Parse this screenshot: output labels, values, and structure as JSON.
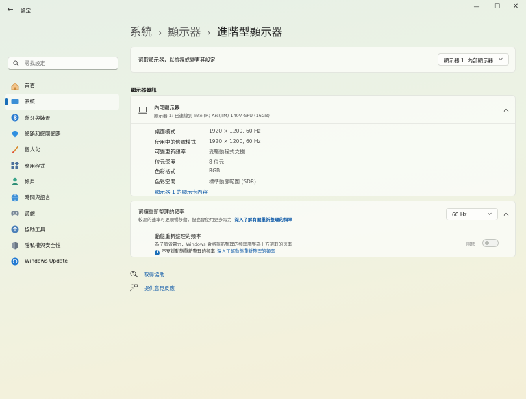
{
  "window": {
    "app_title": "設定",
    "back_label": "←",
    "minimize_label": "—",
    "maximize_label": "☐",
    "close_label": "✕"
  },
  "breadcrumb": {
    "level1": "系統",
    "level2": "顯示器",
    "current": "進階型顯示器",
    "separator": "›"
  },
  "search": {
    "placeholder": "尋找設定"
  },
  "sidebar": {
    "items": [
      {
        "label": "首頁",
        "icon": "home-icon"
      },
      {
        "label": "系統",
        "icon": "system-icon",
        "active": true
      },
      {
        "label": "藍牙與裝置",
        "icon": "bluetooth-icon"
      },
      {
        "label": "網路和網際網路",
        "icon": "wifi-icon"
      },
      {
        "label": "個人化",
        "icon": "brush-icon"
      },
      {
        "label": "應用程式",
        "icon": "apps-icon"
      },
      {
        "label": "帳戶",
        "icon": "person-icon"
      },
      {
        "label": "時間與語言",
        "icon": "globe-clock-icon"
      },
      {
        "label": "遊戲",
        "icon": "gamepad-icon"
      },
      {
        "label": "協助工具",
        "icon": "accessibility-icon"
      },
      {
        "label": "隱私權與安全性",
        "icon": "shield-icon"
      },
      {
        "label": "Windows Update",
        "icon": "update-icon"
      }
    ]
  },
  "select_display": {
    "label": "選取顯示器，以檢視或變更其設定",
    "selected": "顯示器 1: 內部顯示器"
  },
  "display_info": {
    "heading": "顯示器資訊",
    "title": "內部顯示器",
    "subtitle": "顯示器 1: 已連線到 Intel(R) Arc(TM) 140V GPU (16GB)",
    "specs": [
      {
        "label": "桌面模式",
        "value": "1920 × 1200, 60 Hz"
      },
      {
        "label": "使用中的信號模式",
        "value": "1920 × 1200, 60 Hz"
      },
      {
        "label": "可變更新頻率",
        "value": "受驅動程式支援"
      },
      {
        "label": "位元深度",
        "value": "8 位元"
      },
      {
        "label": "色彩格式",
        "value": "RGB"
      },
      {
        "label": "色彩空間",
        "value": "標準動態範圍 (SDR)"
      }
    ],
    "adapter_link": "顯示器 1 的顯示卡內容"
  },
  "refresh_rate": {
    "title": "選擇重新整理的頻率",
    "description": "較高的速率可更順暢移動，但也會使用更多電力",
    "learn_more": "深入了解有關重新整理的頻率",
    "selected": "60 Hz",
    "dynamic": {
      "title": "動態重新整理的頻率",
      "description": "為了節省電力，Windows 會將重新整理的頻率調整為上方選取的速率",
      "note": "不支援動態重新整理的頻率",
      "note_link": "深入了解動態重新整理的頻率",
      "toggle_state_label": "關閉",
      "enabled": false
    }
  },
  "footer_links": {
    "get_help": "取得協助",
    "give_feedback": "提供意見反應"
  },
  "colors": {
    "accent": "#1a6eb8",
    "link": "#0f5aa8"
  }
}
